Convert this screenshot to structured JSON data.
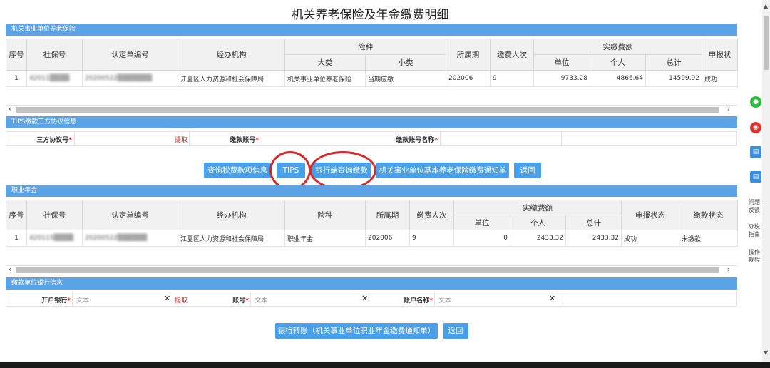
{
  "page_title": "机关养老保险及年金缴费明细",
  "section1": {
    "title": "机关事业单位养老保险",
    "headers": {
      "seq": "序号",
      "ssn": "社保号",
      "cert": "认定单编号",
      "agency": "经办机构",
      "insurance": "险种",
      "major": "大类",
      "minor": "小类",
      "period": "所属期",
      "count": "缴费人次",
      "actual": "实缴费额",
      "unit": "单位",
      "personal": "个人",
      "total": "总计",
      "report": "申报状"
    },
    "row": {
      "seq": "1",
      "ssn": "42011▒▒▒▒",
      "cert": "20200522▒▒▒▒▒▒▒",
      "agency": "江夏区人力资源和社会保障局",
      "major": "机关事业单位养老保险",
      "minor": "当期应缴",
      "period": "202006",
      "count": "9",
      "unit": "9733.28",
      "personal": "4866.64",
      "total": "14599.92",
      "report": "成功"
    }
  },
  "tips": {
    "title": "TIPS缴款三方协议信息",
    "protocol_label": "三方协议号",
    "fetch": "提取",
    "account_label": "缴款账号",
    "account_name_label": "缴款账号名称"
  },
  "buttons1": {
    "query_tax": "查询税费款项信息",
    "tips": "TIPS",
    "bank_query": "银行端查询缴款",
    "notice": "机关事业单位基本养老保险缴费通知单",
    "back": "返回"
  },
  "section2": {
    "title": "职业年金",
    "headers": {
      "seq": "序号",
      "ssn": "社保号",
      "cert": "认定单编号",
      "agency": "经办机构",
      "insurance": "险种",
      "period": "所属期",
      "count": "缴费人次",
      "actual": "实缴费额",
      "unit": "单位",
      "personal": "个人",
      "total": "总计",
      "report": "申报状态",
      "pay": "缴款状态"
    },
    "row": {
      "seq": "1",
      "ssn": "420115▒▒▒▒",
      "cert": "20200522▒▒▒▒▒▒",
      "agency": "江夏区人力资源和社会保障局",
      "insurance": "职业年金",
      "period": "202006",
      "count": "9",
      "unit": "0",
      "personal": "2433.32",
      "total": "2433.32",
      "report": "成功",
      "pay": "未缴款"
    }
  },
  "bank": {
    "title": "缴款单位银行信息",
    "bank_label": "开户银行",
    "bank_ph": "文本",
    "fetch": "提取",
    "account_label": "账号",
    "account_ph": "文本",
    "name_label": "账户名称",
    "name_ph": "文本"
  },
  "buttons2": {
    "transfer": "银行转账（机关事业单位职业年金缴费通知单）",
    "back": "返回"
  },
  "rail": {
    "item1": "问题反馈",
    "item2": "办税指南",
    "item3": "操作规程"
  }
}
